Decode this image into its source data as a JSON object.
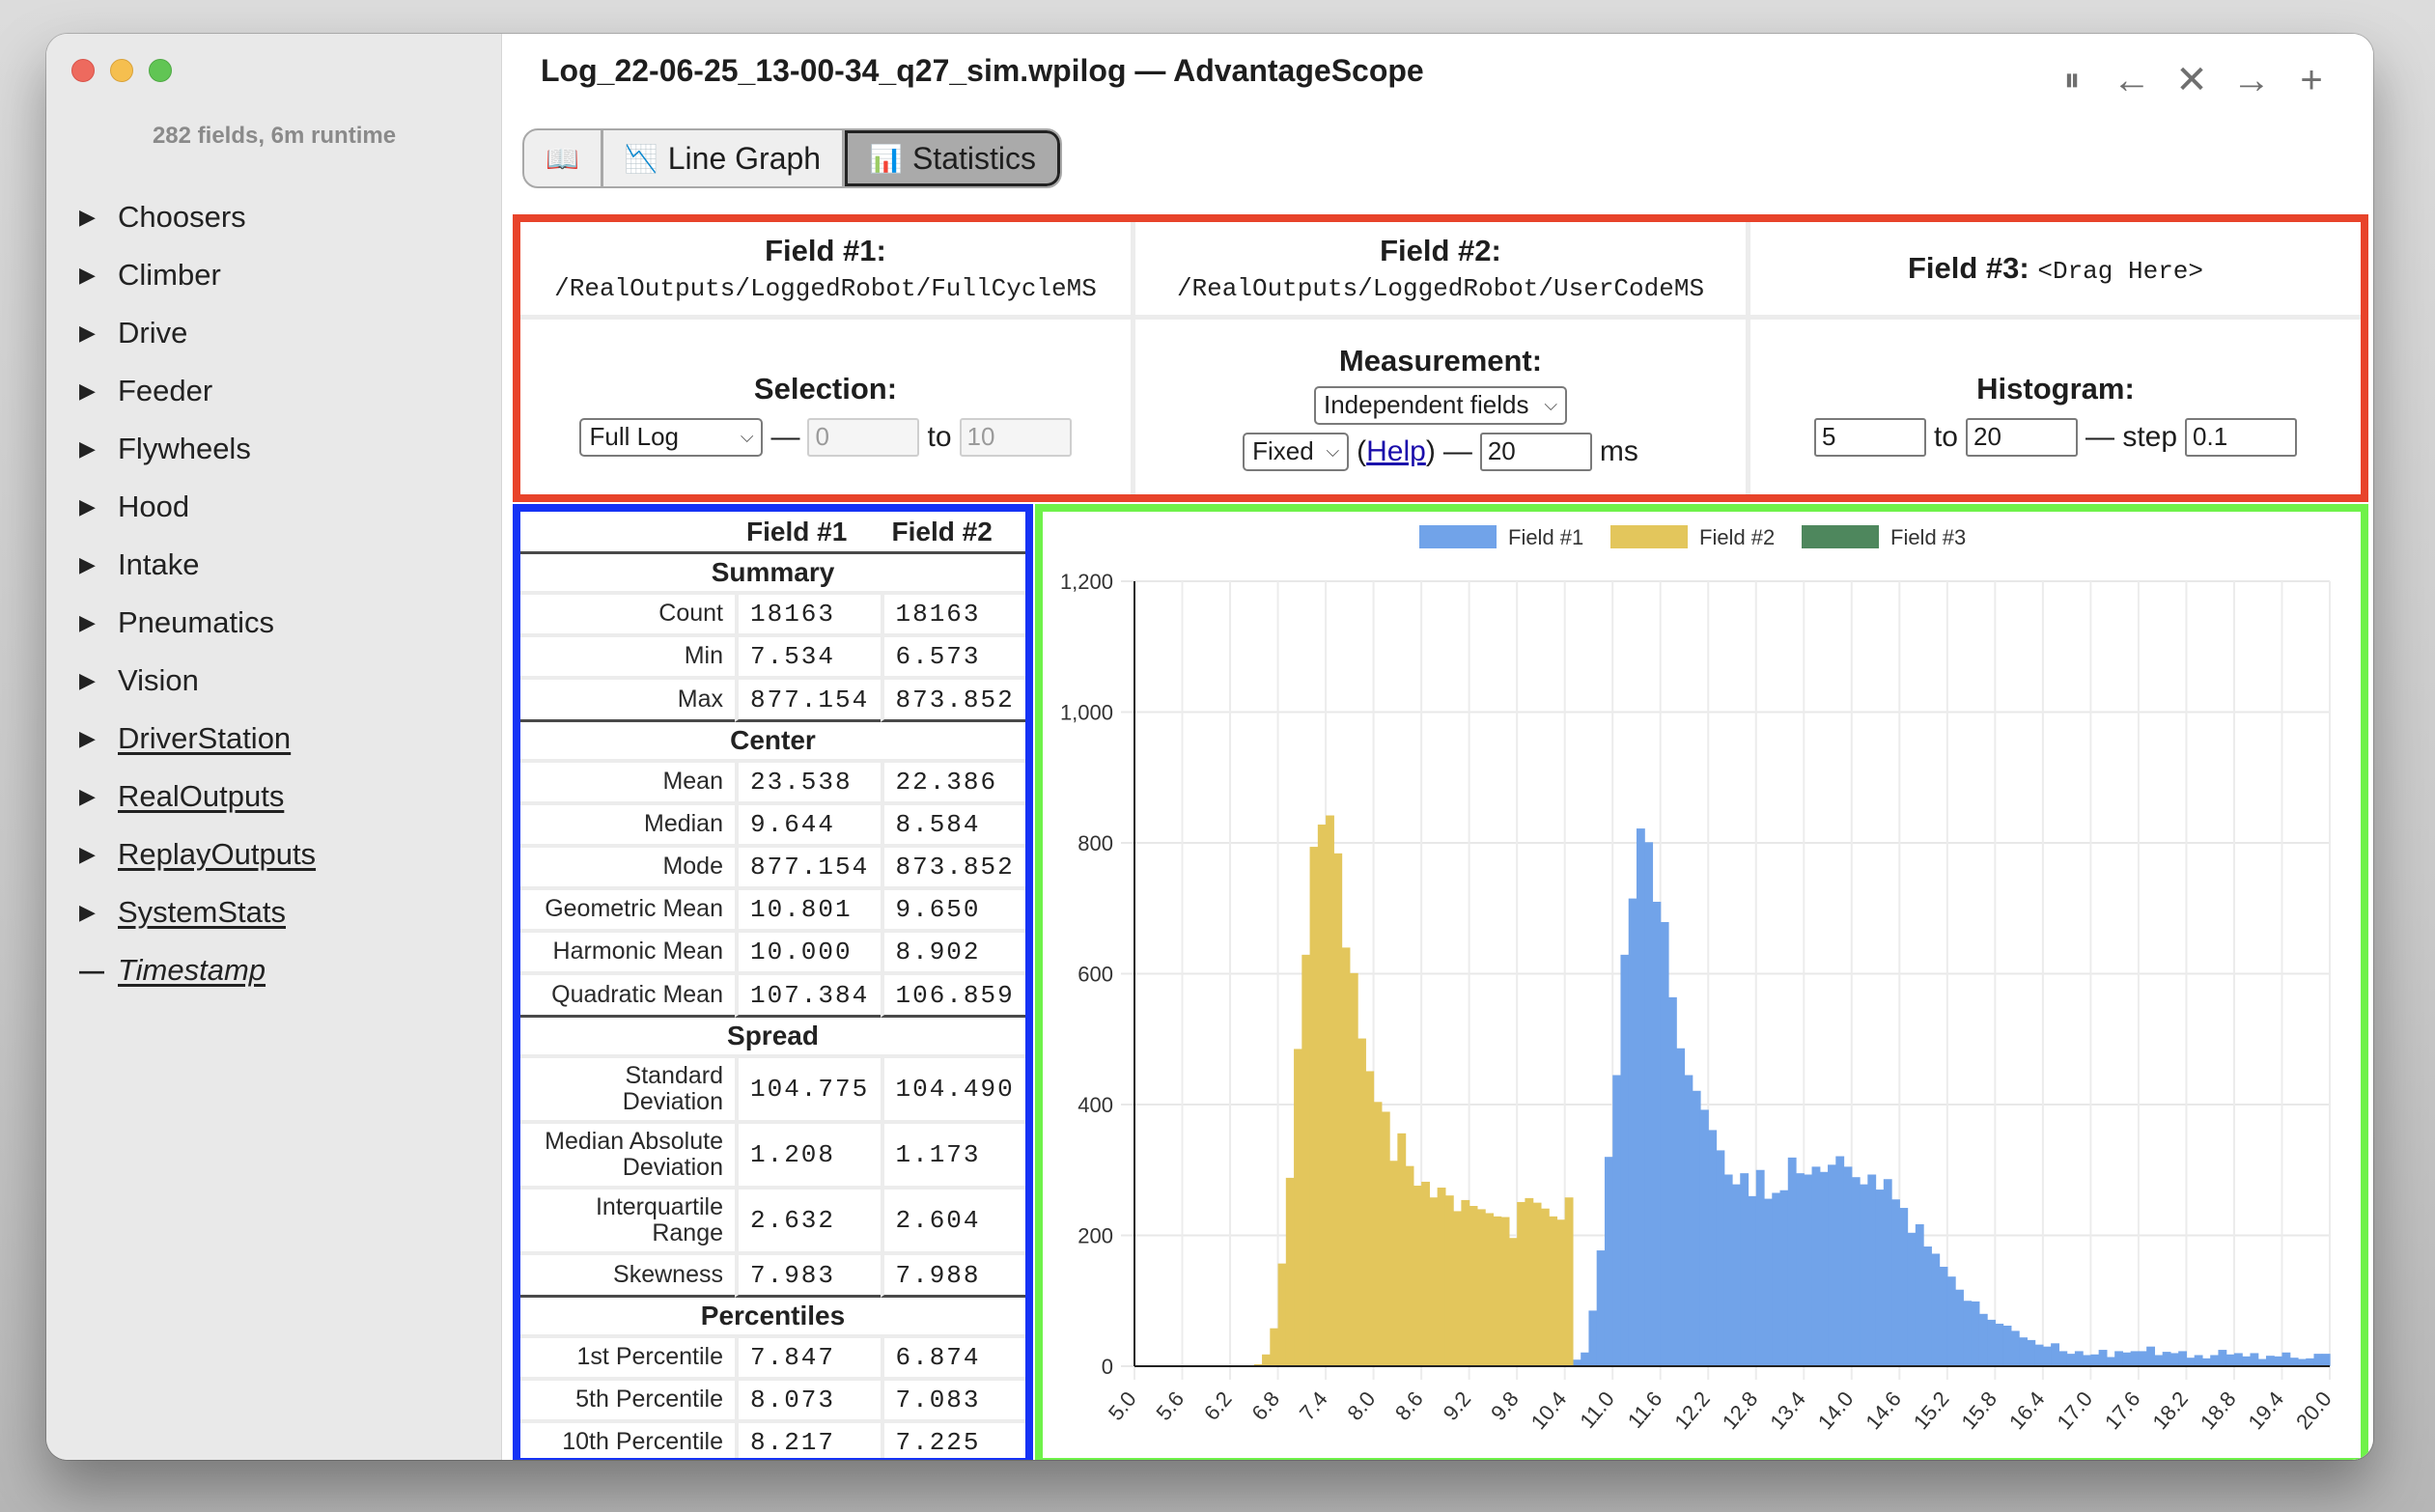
{
  "window": {
    "title": "Log_22-06-25_13-00-34_q27_sim.wpilog — AdvantageScope",
    "controls": [
      {
        "name": "pause",
        "glyph": "⏸︎",
        "icon": "pause-icon"
      },
      {
        "name": "back",
        "glyph": "←",
        "icon": "arrow-left-icon"
      },
      {
        "name": "close-tab",
        "glyph": "✕",
        "icon": "close-icon"
      },
      {
        "name": "forward",
        "glyph": "→",
        "icon": "arrow-right-icon"
      },
      {
        "name": "add-tab",
        "glyph": "+",
        "icon": "plus-icon"
      }
    ]
  },
  "sidebar": {
    "summary": "282 fields, 6m runtime",
    "items": [
      {
        "label": "Choosers",
        "marker": "▶",
        "style": "plain"
      },
      {
        "label": "Climber",
        "marker": "▶",
        "style": "plain"
      },
      {
        "label": "Drive",
        "marker": "▶",
        "style": "plain"
      },
      {
        "label": "Feeder",
        "marker": "▶",
        "style": "plain"
      },
      {
        "label": "Flywheels",
        "marker": "▶",
        "style": "plain"
      },
      {
        "label": "Hood",
        "marker": "▶",
        "style": "plain"
      },
      {
        "label": "Intake",
        "marker": "▶",
        "style": "plain"
      },
      {
        "label": "Pneumatics",
        "marker": "▶",
        "style": "plain"
      },
      {
        "label": "Vision",
        "marker": "▶",
        "style": "plain"
      },
      {
        "label": "DriverStation",
        "marker": "▶",
        "style": "underline"
      },
      {
        "label": "RealOutputs",
        "marker": "▶",
        "style": "underline"
      },
      {
        "label": "ReplayOutputs",
        "marker": "▶",
        "style": "underline"
      },
      {
        "label": "SystemStats",
        "marker": "▶",
        "style": "underline"
      },
      {
        "label": "Timestamp",
        "marker": "—",
        "style": "italic-underline"
      }
    ]
  },
  "tabs": [
    {
      "label": "",
      "icon": "📖",
      "icon_name": "book-icon",
      "active": false
    },
    {
      "label": "Line Graph",
      "icon": "📉",
      "icon_name": "line-graph-icon",
      "active": false
    },
    {
      "label": "Statistics",
      "icon": "📊",
      "icon_name": "bar-chart-icon",
      "active": true
    }
  ],
  "config": {
    "field1": {
      "label": "Field #1:",
      "path": "/RealOutputs/LoggedRobot/FullCycleMS"
    },
    "field2": {
      "label": "Field #2:",
      "path": "/RealOutputs/LoggedRobot/UserCodeMS"
    },
    "field3": {
      "label": "Field #3:",
      "placeholder": "<Drag Here>"
    },
    "selection": {
      "label": "Selection:",
      "mode": "Full Log",
      "dash": "—",
      "from": "0",
      "to_label": "to",
      "to": "10"
    },
    "measurement": {
      "label": "Measurement:",
      "mode": "Independent fields",
      "sampling": "Fixed",
      "help_open": "(",
      "help_label": "Help",
      "help_close": ")",
      "dash": "—",
      "period": "20",
      "unit": "ms"
    },
    "histogram": {
      "label": "Histogram:",
      "min": "5",
      "to_label": "to",
      "max": "20",
      "step_label": "— step",
      "step": "0.1"
    }
  },
  "stats": {
    "columns": [
      "",
      "Field #1",
      "Field #2"
    ],
    "sections": [
      {
        "title": "Summary",
        "rows": [
          {
            "name": "Count",
            "f1": "18163",
            "f2": "18163"
          },
          {
            "name": "Min",
            "f1": "7.534",
            "f2": "6.573"
          },
          {
            "name": "Max",
            "f1": "877.154",
            "f2": "873.852"
          }
        ]
      },
      {
        "title": "Center",
        "rows": [
          {
            "name": "Mean",
            "f1": "23.538",
            "f2": "22.386"
          },
          {
            "name": "Median",
            "f1": "9.644",
            "f2": "8.584"
          },
          {
            "name": "Mode",
            "f1": "877.154",
            "f2": "873.852"
          },
          {
            "name": "Geometric Mean",
            "f1": "10.801",
            "f2": "9.650"
          },
          {
            "name": "Harmonic Mean",
            "f1": "10.000",
            "f2": "8.902"
          },
          {
            "name": "Quadratic Mean",
            "f1": "107.384",
            "f2": "106.859"
          }
        ]
      },
      {
        "title": "Spread",
        "rows": [
          {
            "name": "Standard Deviation",
            "f1": "104.775",
            "f2": "104.490"
          },
          {
            "name": "Median Absolute Deviation",
            "f1": "1.208",
            "f2": "1.173"
          },
          {
            "name": "Interquartile Range",
            "f1": "2.632",
            "f2": "2.604"
          },
          {
            "name": "Skewness",
            "f1": "7.983",
            "f2": "7.988"
          }
        ]
      },
      {
        "title": "Percentiles",
        "rows": [
          {
            "name": "1st Percentile",
            "f1": "7.847",
            "f2": "6.874"
          },
          {
            "name": "5th Percentile",
            "f1": "8.073",
            "f2": "7.083"
          },
          {
            "name": "10th Percentile",
            "f1": "8.217",
            "f2": "7.225"
          }
        ]
      }
    ]
  },
  "chart_data": {
    "type": "bar",
    "stacked": true,
    "title": "",
    "xlabel": "",
    "ylabel": "",
    "bin_start": 5.0,
    "bin_step": 0.1,
    "xlim": [
      5.0,
      20.0
    ],
    "ylim": [
      0,
      1200
    ],
    "y_ticks": [
      0,
      200,
      400,
      600,
      800,
      1000,
      1200
    ],
    "y_tick_labels": [
      "0",
      "200",
      "400",
      "600",
      "800",
      "1,000",
      "1,200"
    ],
    "x_tick_labels": [
      "5.0",
      "5.6",
      "6.2",
      "6.8",
      "7.4",
      "8.0",
      "8.6",
      "9.2",
      "9.8",
      "10.4",
      "11.0",
      "11.6",
      "12.2",
      "12.8",
      "13.4",
      "14.0",
      "14.6",
      "15.2",
      "15.8",
      "16.4",
      "17.0",
      "17.6",
      "18.2",
      "18.8",
      "19.4",
      "20.0"
    ],
    "grid": true,
    "legend": {
      "position": "top-center",
      "entries": [
        {
          "name": "Field #1",
          "color": "#71a3e9"
        },
        {
          "name": "Field #2",
          "color": "#e3c65c"
        },
        {
          "name": "Field #3",
          "color": "#4e875d"
        }
      ]
    },
    "series": [
      {
        "name": "Field #1",
        "color": "#71a3e9",
        "values": [
          0,
          0,
          0,
          0,
          0,
          0,
          0,
          0,
          0,
          0,
          0,
          0,
          0,
          0,
          0,
          0,
          0,
          0,
          0,
          0,
          0,
          0,
          0,
          0,
          0,
          0,
          0,
          0,
          0,
          0,
          0,
          0,
          0,
          0,
          0,
          0,
          0,
          0,
          0,
          0,
          0,
          0,
          0,
          0,
          0,
          0,
          0,
          0,
          0,
          0,
          0,
          0,
          0,
          0,
          0,
          10,
          21,
          85,
          177,
          320,
          445,
          629,
          715,
          822,
          801,
          710,
          679,
          564,
          486,
          445,
          421,
          392,
          361,
          330,
          293,
          278,
          295,
          260,
          300,
          256,
          265,
          269,
          319,
          295,
          293,
          305,
          297,
          308,
          321,
          305,
          289,
          278,
          293,
          270,
          286,
          255,
          242,
          204,
          217,
          183,
          172,
          152,
          137,
          117,
          100,
          99,
          80,
          71,
          65,
          62,
          54,
          44,
          40,
          33,
          30,
          35,
          23,
          19,
          23,
          17,
          18,
          25,
          14,
          23,
          21,
          23,
          23,
          30,
          17,
          22,
          20,
          23,
          13,
          17,
          12,
          17,
          25,
          18,
          20,
          15,
          20,
          11,
          16,
          15,
          21,
          13,
          11,
          12,
          19,
          19,
          11,
          14,
          13,
          6,
          11,
          6,
          16,
          10,
          14,
          10,
          9,
          8,
          2,
          6,
          12,
          5,
          8,
          8,
          7,
          4,
          6,
          4,
          2,
          6,
          4,
          0,
          3,
          2,
          5,
          7
        ]
      },
      {
        "name": "Field #2",
        "color": "#e3c65c",
        "values": [
          0,
          0,
          0,
          0,
          0,
          0,
          0,
          0,
          0,
          0,
          0,
          0,
          0,
          0,
          0,
          3,
          18,
          58,
          157,
          288,
          485,
          629,
          794,
          828,
          842,
          784,
          640,
          601,
          501,
          451,
          404,
          389,
          314,
          356,
          306,
          276,
          282,
          258,
          273,
          261,
          237,
          254,
          245,
          240,
          234,
          229,
          228,
          196,
          251,
          257,
          250,
          241,
          229,
          224,
          258,
          0,
          0,
          0,
          0,
          0,
          0,
          0,
          0,
          0,
          0
        ]
      },
      {
        "name": "Field #3",
        "color": "#4e875d",
        "values": []
      }
    ]
  }
}
